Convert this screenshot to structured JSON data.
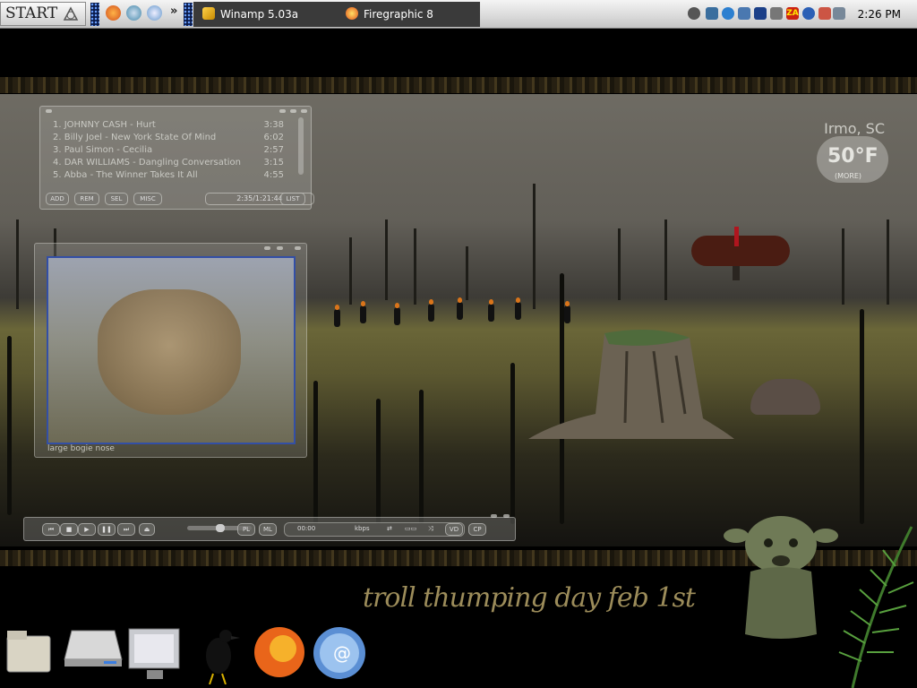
{
  "taskbar": {
    "start_label": "START",
    "quicklaunch_overflow": "»",
    "tasks": [
      {
        "label": "Winamp 5.03a",
        "icon": "winamp-icon"
      },
      {
        "label": "Firegraphic 8",
        "icon": "firefox-icon"
      }
    ],
    "clock": "2:26 PM"
  },
  "playlist": {
    "tracks": [
      {
        "title": "1. JOHNNY CASH - Hurt",
        "duration": "3:38"
      },
      {
        "title": "2. Billy Joel - New York State Of Mind",
        "duration": "6:02"
      },
      {
        "title": "3. Paul Simon - Cecilia",
        "duration": "2:57"
      },
      {
        "title": "4. DAR WILLIAMS - Dangling Conversation",
        "duration": "3:15"
      },
      {
        "title": "5. Abba - The Winner Takes It All",
        "duration": "4:55"
      }
    ],
    "buttons": {
      "add": "ADD",
      "rem": "REM",
      "sel": "SEL",
      "misc": "MISC",
      "list": "LIST"
    },
    "time": "2:35/1:21:44"
  },
  "video": {
    "caption": "large bogie nose"
  },
  "player": {
    "pl": "PL",
    "ml": "ML",
    "time": "00:00",
    "kbps": "kbps",
    "vd": "VD",
    "cp": "CP"
  },
  "weather": {
    "city": "Irmo, SC",
    "temp": "50°F",
    "more": "(MORE)"
  },
  "wallpaper": {
    "motto": "troll thumping day   feb 1st"
  },
  "colors": {
    "accent": "#334fa6",
    "motto": "#9c8c5a",
    "taskbar": "#d9d9d9"
  }
}
